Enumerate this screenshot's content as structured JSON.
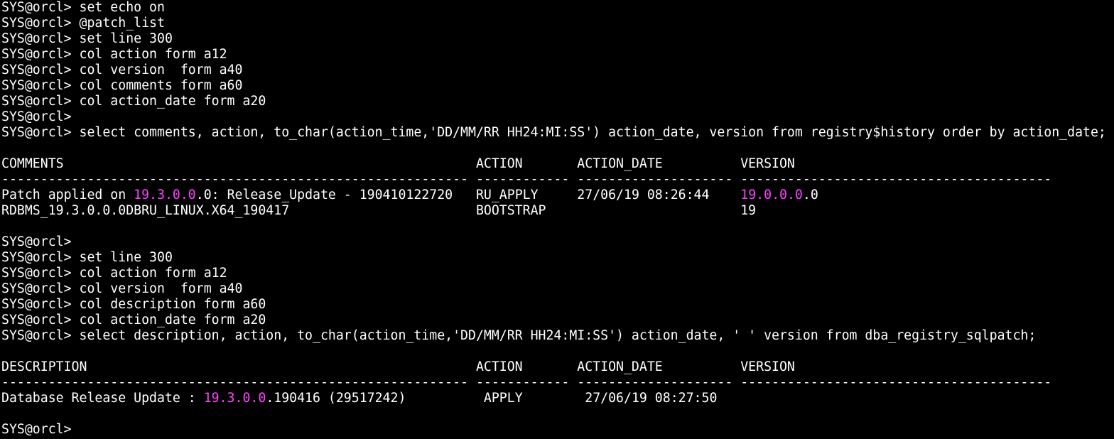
{
  "colors": {
    "background": "#000000",
    "text": "#ffffff",
    "highlight": "#ff40ff"
  },
  "lines": [
    [
      {
        "text": "SYS@orcl> set echo on"
      }
    ],
    [
      {
        "text": "SYS@orcl> @patch_list"
      }
    ],
    [
      {
        "text": "SYS@orcl> set line 300"
      }
    ],
    [
      {
        "text": "SYS@orcl> col action form a12"
      }
    ],
    [
      {
        "text": "SYS@orcl> col version  form a40"
      }
    ],
    [
      {
        "text": "SYS@orcl> col comments form a60"
      }
    ],
    [
      {
        "text": "SYS@orcl> col action_date form a20"
      }
    ],
    [
      {
        "text": "SYS@orcl>"
      }
    ],
    [
      {
        "text": "SYS@orcl> select comments, action, to_char(action_time,'DD/MM/RR HH24:MI:SS') action_date, version from registry$history order by action_date;"
      }
    ],
    [
      {
        "text": ""
      }
    ],
    [
      {
        "text": "COMMENTS                                                     ACTION       ACTION_DATE          VERSION"
      }
    ],
    [
      {
        "text": "------------------------------------------------------------ ------------ -------------------- ----------------------------------------"
      }
    ],
    [
      {
        "text": "Patch applied on "
      },
      {
        "text": "19.3.0.0",
        "hl": true
      },
      {
        "text": ".0: Release_Update - 190410122720   RU_APPLY     27/06/19 08:26:44    "
      },
      {
        "text": "19.0.0.0",
        "hl": true
      },
      {
        "text": ".0"
      }
    ],
    [
      {
        "text": "RDBMS_19.3.0.0.0DBRU_LINUX.X64_190417                        BOOTSTRAP                         19"
      }
    ],
    [
      {
        "text": ""
      }
    ],
    [
      {
        "text": "SYS@orcl>"
      }
    ],
    [
      {
        "text": "SYS@orcl> set line 300"
      }
    ],
    [
      {
        "text": "SYS@orcl> col action form a12"
      }
    ],
    [
      {
        "text": "SYS@orcl> col version  form a40"
      }
    ],
    [
      {
        "text": "SYS@orcl> col description form a60"
      }
    ],
    [
      {
        "text": "SYS@orcl> col action_date form a20"
      }
    ],
    [
      {
        "text": "SYS@orcl> select description, action, to_char(action_time,'DD/MM/RR HH24:MI:SS') action_date, ' ' version from dba_registry_sqlpatch;"
      }
    ],
    [
      {
        "text": ""
      }
    ],
    [
      {
        "text": "DESCRIPTION                                                  ACTION       ACTION_DATE          VERSION"
      }
    ],
    [
      {
        "text": "------------------------------------------------------------ ------------ -------------------- ----------------------------------------"
      }
    ],
    [
      {
        "text": "Database Release Update : "
      },
      {
        "text": "19.3.0.0",
        "hl": true
      },
      {
        "text": ".190416 (29517242)          APPLY        27/06/19 08:27:50"
      }
    ],
    [
      {
        "text": ""
      }
    ],
    [
      {
        "text": "SYS@orcl>"
      }
    ]
  ]
}
